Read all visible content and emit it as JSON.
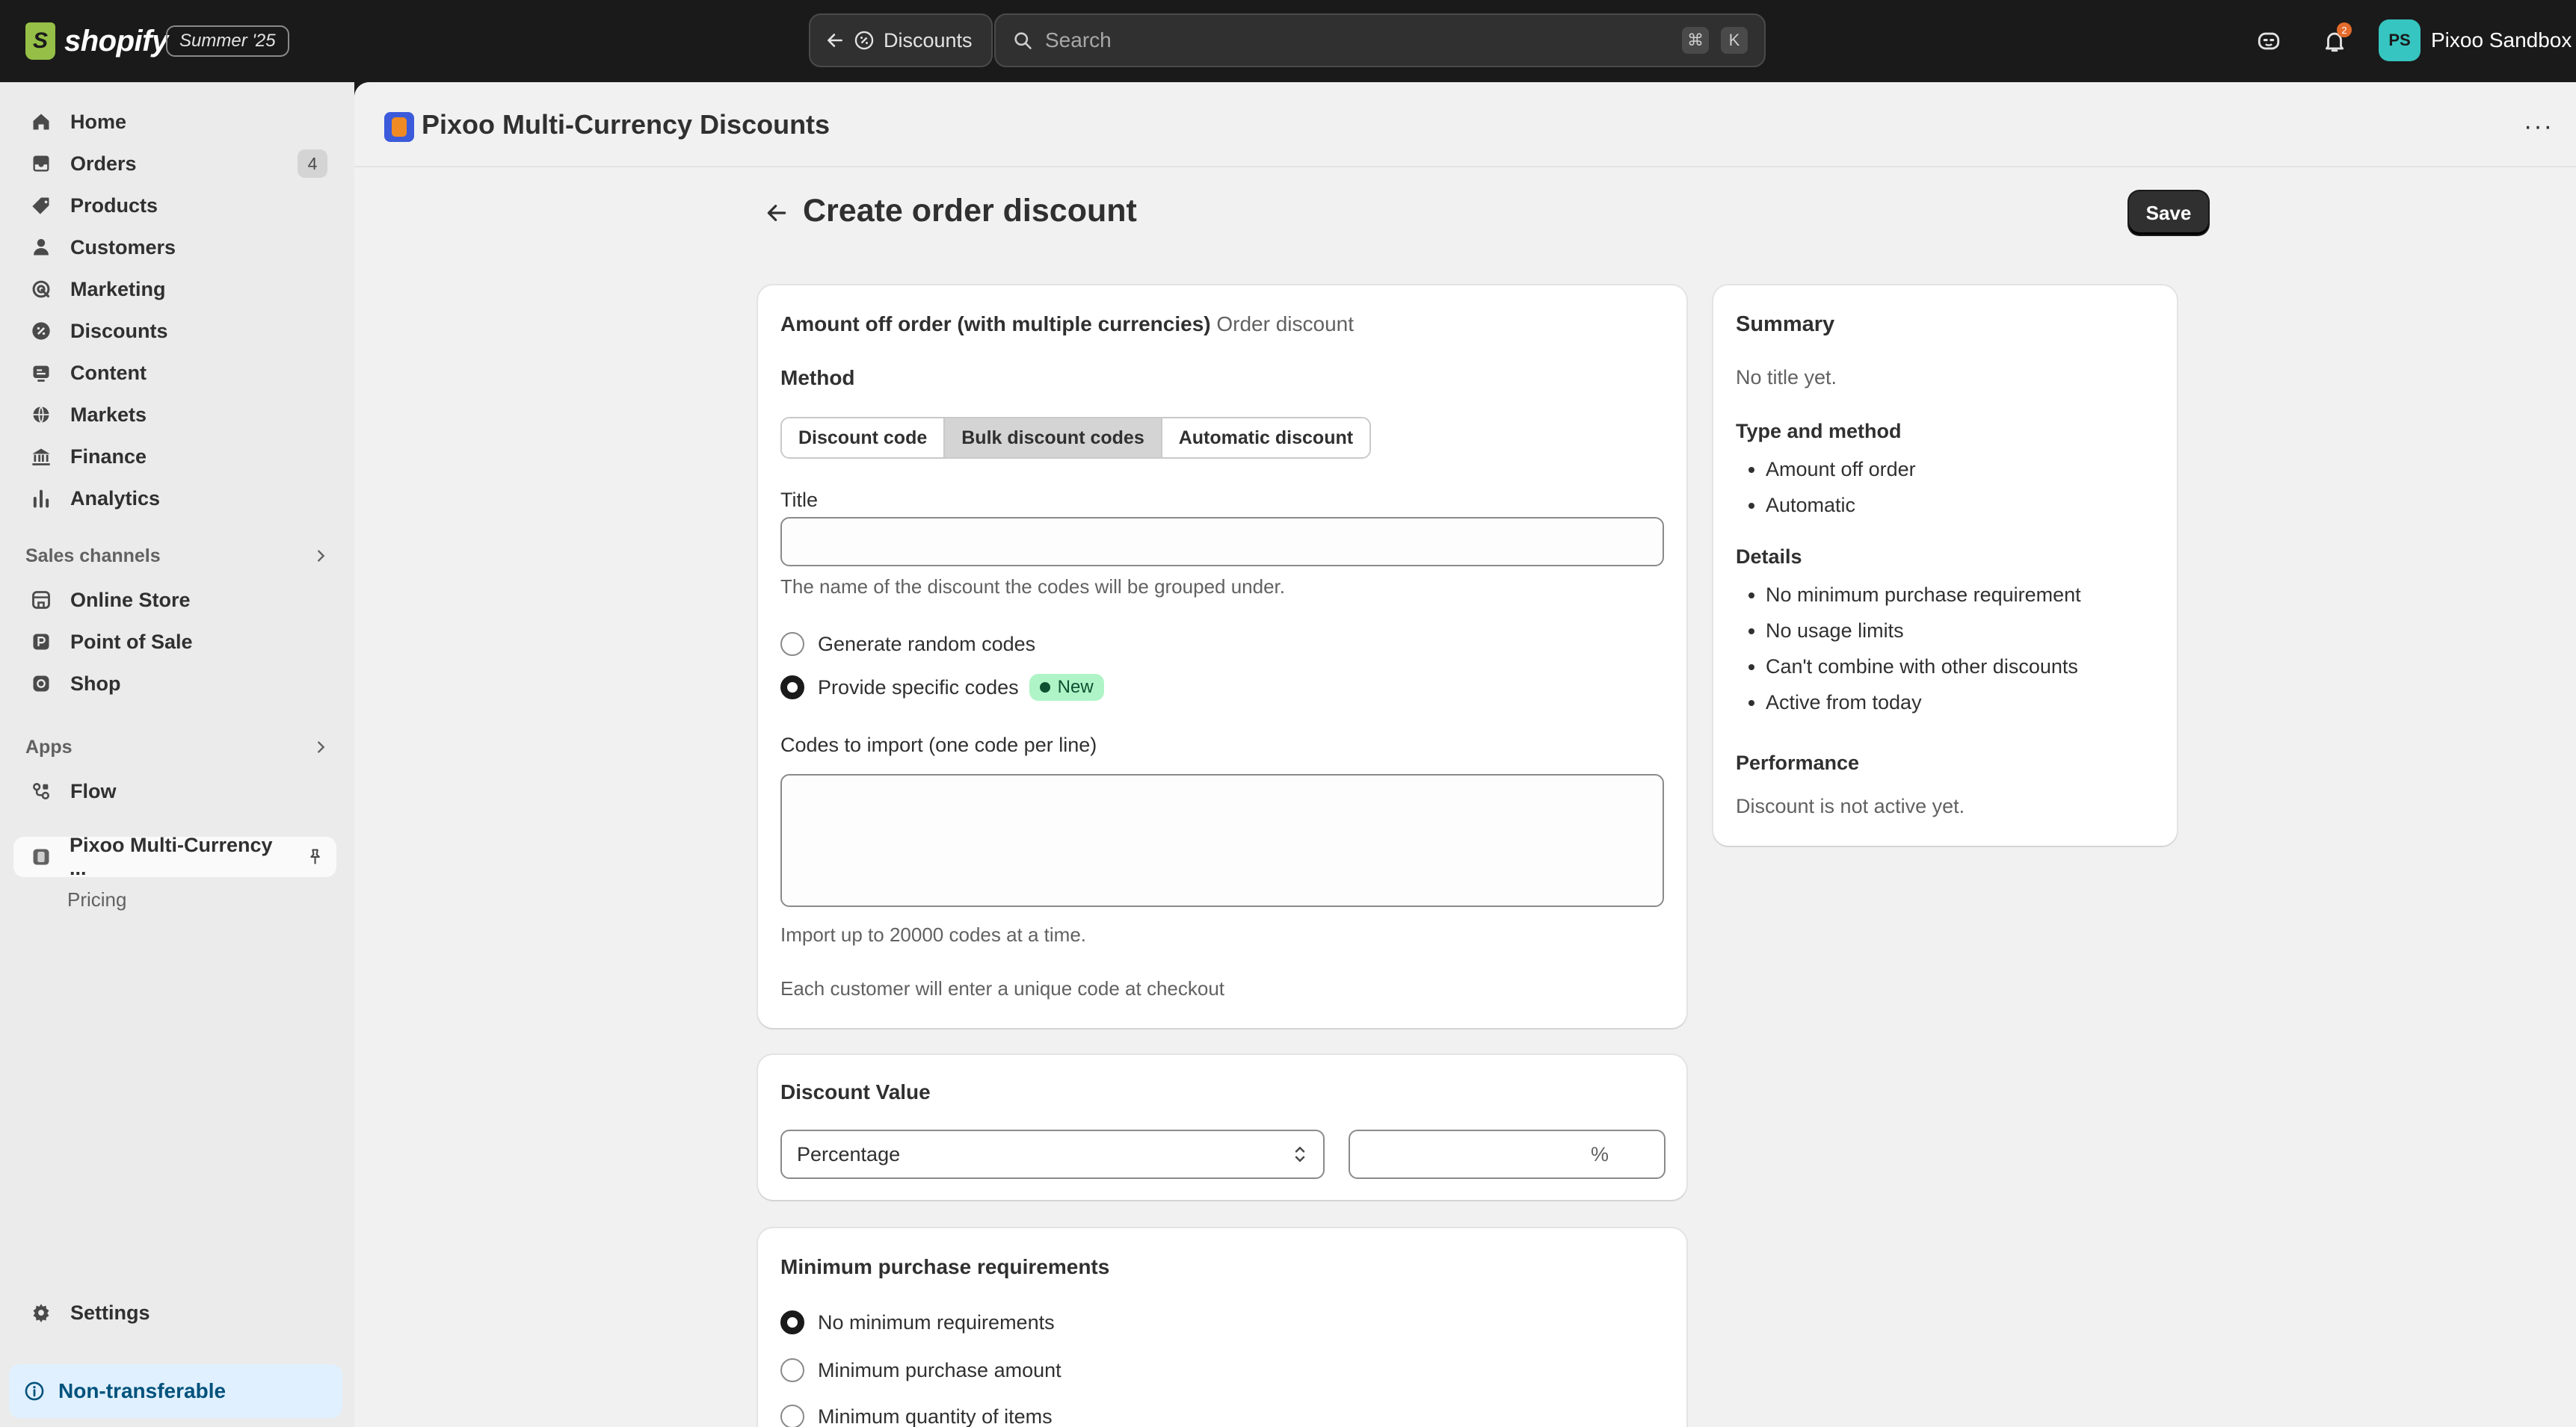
{
  "topbar": {
    "brand": "shopify",
    "edition": "Summer '25",
    "crumb_label": "Discounts",
    "search_placeholder": "Search",
    "kbd_cmd": "⌘",
    "kbd_k": "K",
    "notification_count": "2",
    "avatar_initials": "PS",
    "store_name": "Pixoo Sandbox"
  },
  "sidebar": {
    "items": [
      {
        "label": "Home"
      },
      {
        "label": "Orders",
        "count": "4"
      },
      {
        "label": "Products"
      },
      {
        "label": "Customers"
      },
      {
        "label": "Marketing"
      },
      {
        "label": "Discounts"
      },
      {
        "label": "Content"
      },
      {
        "label": "Markets"
      },
      {
        "label": "Finance"
      },
      {
        "label": "Analytics"
      }
    ],
    "sales_channels_label": "Sales channels",
    "channels": [
      {
        "label": "Online Store"
      },
      {
        "label": "Point of Sale"
      },
      {
        "label": "Shop"
      }
    ],
    "apps_label": "Apps",
    "apps": [
      {
        "label": "Flow"
      }
    ],
    "pinned_app": "Pixoo Multi-Currency ...",
    "pinned_sub": "Pricing",
    "settings_label": "Settings",
    "nontransferable_label": "Non-transferable"
  },
  "app": {
    "title": "Pixoo Multi-Currency Discounts",
    "more": "···"
  },
  "page": {
    "title": "Create order discount",
    "save_label": "Save"
  },
  "discount_card": {
    "title": "Amount off order (with multiple currencies)",
    "subtitle": "Order discount",
    "method_label": "Method",
    "methods": [
      "Discount code",
      "Bulk discount codes",
      "Automatic discount"
    ],
    "selected_method": "Bulk discount codes",
    "title_label": "Title",
    "title_value": "",
    "title_help": "The name of the discount the codes will be grouped under.",
    "option_random": "Generate random codes",
    "option_specific": "Provide specific codes",
    "new_badge": "New",
    "codes_label": "Codes to import (one code per line)",
    "codes_value": "",
    "import_help": "Import up to 20000 codes at a time.",
    "checkout_help": "Each customer will enter a unique code at checkout"
  },
  "value_card": {
    "title": "Discount Value",
    "type_selected": "Percentage",
    "amount_value": "",
    "suffix": "%"
  },
  "min_card": {
    "title": "Minimum purchase requirements",
    "options": [
      "No minimum requirements",
      "Minimum purchase amount",
      "Minimum quantity of items"
    ],
    "selected_index": 0
  },
  "summary": {
    "title": "Summary",
    "no_title": "No title yet.",
    "type_heading": "Type and method",
    "type_items": [
      "Amount off order",
      "Automatic"
    ],
    "details_heading": "Details",
    "details_items": [
      "No minimum purchase requirement",
      "No usage limits",
      "Can't combine with other discounts",
      "Active from today"
    ],
    "performance_heading": "Performance",
    "performance_text": "Discount is not active yet."
  },
  "colors": {
    "topbar_bg": "#1a1a1a",
    "sidebar_bg": "#ebebeb",
    "main_bg": "#f1f1f1",
    "new_badge_bg": "#aff4c6",
    "info_bg": "#e0f0ff"
  }
}
